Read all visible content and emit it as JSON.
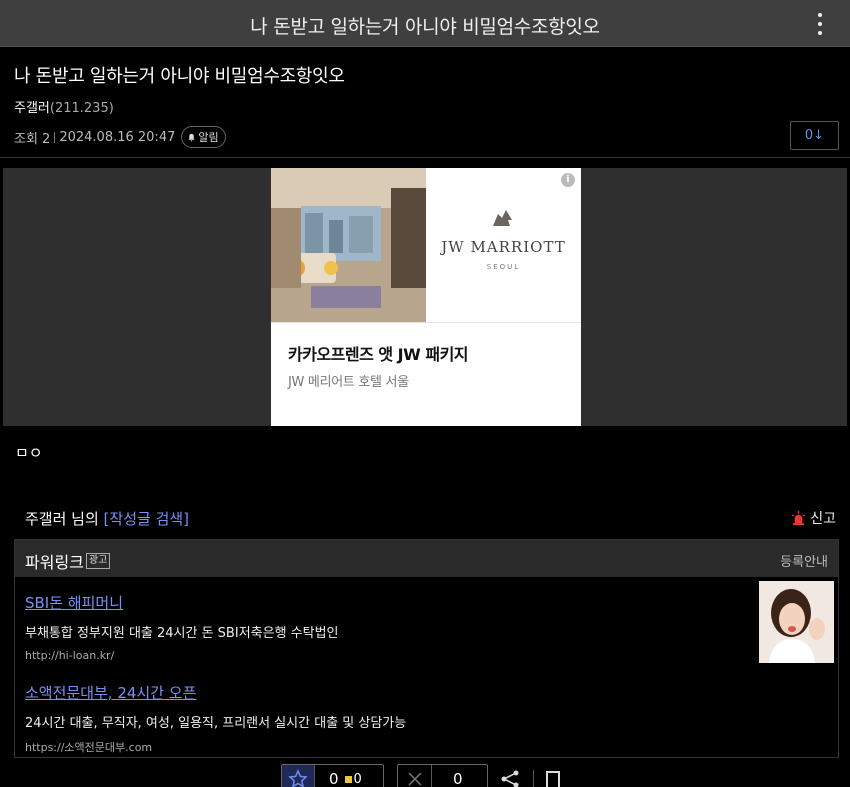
{
  "header": {
    "title": "나 돈받고 일하는거 아니야 비밀엄수조항잇오",
    "menu_icon": "more-vertical-icon"
  },
  "post": {
    "title": "나 돈받고 일하는거 아니야 비밀엄수조항잇오",
    "author": "주갤러",
    "author_ip": "(211.235)",
    "views": "조회 2",
    "datetime": "2024.08.16 20:47",
    "alarm_label": "알림",
    "comment_jump": "0↓",
    "body": "ㅁㅇ"
  },
  "ad": {
    "brand": "JW MARRIOTT",
    "city": "SEOUL",
    "headline": "카카오프렌즈 앳 JW 패키지",
    "subline": "JW 메리어트 호텔 서울",
    "info_label": "i"
  },
  "author_search": {
    "prefix": "주갤러 님의 ",
    "link": "[작성글 검색]"
  },
  "report": {
    "label": "신고"
  },
  "powerlink": {
    "title": "파워링크",
    "ad_tag": "광고",
    "guide": "등록안내",
    "items": [
      {
        "title": "SBI돈 해피머니",
        "desc": "부채통합 정부지원 대출 24시간 돈 SBI저축은행 수탁법인",
        "url": "http://hi-loan.kr/"
      },
      {
        "title": "소액전문대부, 24시간 오픈",
        "desc": "24시간 대출, 무직자, 여성, 일용직, 프리랜서 실시간 대출 및 상담가능",
        "url": "https://소액전문대부.com"
      }
    ]
  },
  "vote": {
    "recommend_count": "0",
    "fixed_count": "0",
    "nonrecommend_count": "0"
  },
  "colors": {
    "accent_link": "#7b8ff5",
    "topbar_bg": "#3f3f3f",
    "report_red": "#e53935"
  }
}
